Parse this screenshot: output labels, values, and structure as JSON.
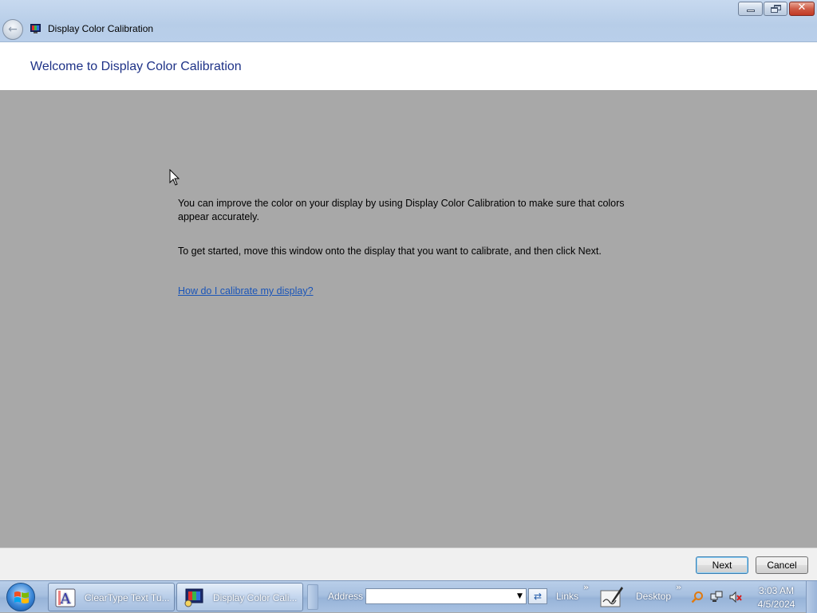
{
  "window": {
    "title": "Display Color Calibration",
    "caption_buttons": [
      "minimize",
      "restore",
      "close"
    ],
    "close_glyph": "✕"
  },
  "header": {
    "heading": "Welcome to Display Color Calibration"
  },
  "main": {
    "paragraph_1": "You can improve the color on your display by using Display Color Calibration to make sure that colors appear accurately.",
    "paragraph_2": "To get started, move this window onto the display that you want to calibrate, and then click Next.",
    "help_link": "How do I calibrate my display?"
  },
  "footer": {
    "next_label": "Next",
    "cancel_label": "Cancel"
  },
  "taskbar": {
    "tasks": [
      {
        "label": "ClearType Text Tu...",
        "icon": "cleartype-icon"
      },
      {
        "label": "Display Color Cali...",
        "icon": "display-calibration-icon",
        "active": true
      }
    ],
    "address_label": "Address",
    "address_value": "",
    "links_label": "Links",
    "desktop_label": "Desktop",
    "chevron": "»",
    "clock_time": "3:03 AM",
    "clock_date": "4/5/2024",
    "tray_icons": [
      "search-icon",
      "network-icon",
      "volume-muted-icon"
    ]
  },
  "colors": {
    "content_bg": "#a8a8a8",
    "heading": "#1e3287",
    "link": "#1a55b8",
    "titlebar": "#b9cfea",
    "footer_bg": "#f0f0f0"
  }
}
